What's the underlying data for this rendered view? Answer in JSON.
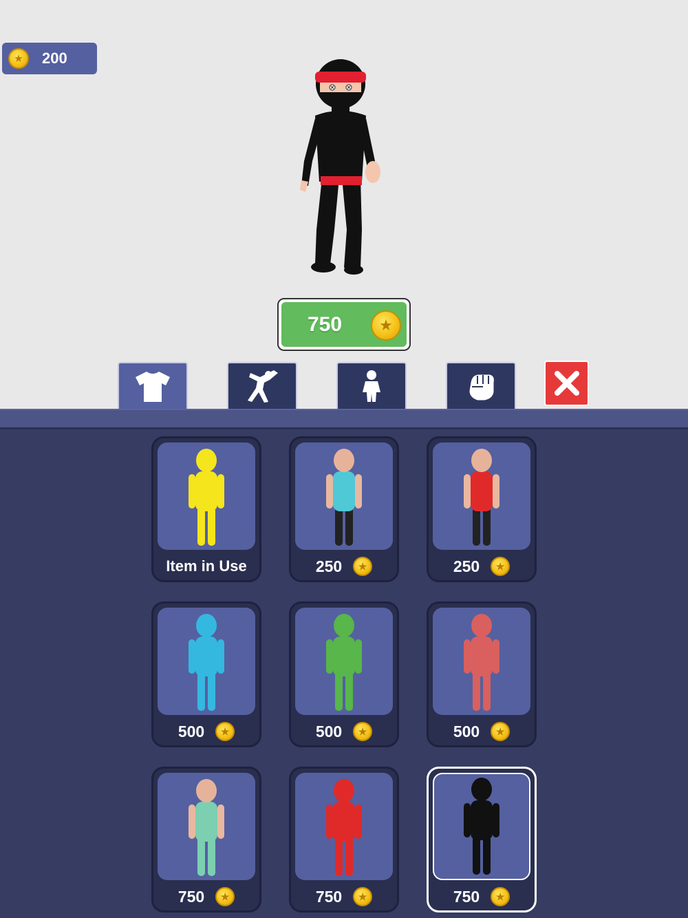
{
  "coins": {
    "count": "200",
    "icon": "star-coin-icon"
  },
  "buy_button": {
    "price": "750"
  },
  "tabs": [
    {
      "name": "tab-outfits",
      "icon": "shirt-icon",
      "active": true
    },
    {
      "name": "tab-dances",
      "icon": "dance-pose-icon",
      "active": false
    },
    {
      "name": "tab-body",
      "icon": "body-icon",
      "active": false
    },
    {
      "name": "tab-fists",
      "icon": "fist-icon",
      "active": false
    }
  ],
  "close_icon": "close-icon",
  "colors": {
    "panel": "#363c62",
    "card": "#5560a0",
    "buy": "#62bb5c",
    "close": "#e63a3a"
  },
  "skins": [
    {
      "label": "Item in Use",
      "in_use": true,
      "body": "#f5e51c",
      "shirt": "#f5e51c",
      "pants": "#f5e51c",
      "head": "#f5e51c"
    },
    {
      "label": "250",
      "body": "#e8b8a0",
      "shirt": "#4fc9d6",
      "pants": "#222",
      "head": "#e6b39a"
    },
    {
      "label": "250",
      "body": "#e8b8a0",
      "shirt": "#e02a2a",
      "pants": "#222",
      "head": "#e6b39a"
    },
    {
      "label": "500",
      "body": "#35b8e0",
      "shirt": "#35b8e0",
      "pants": "#35b8e0",
      "head": "#35b8e0"
    },
    {
      "label": "500",
      "body": "#58b64a",
      "shirt": "#58b64a",
      "pants": "#58b64a",
      "head": "#58b64a"
    },
    {
      "label": "500",
      "body": "#d9605e",
      "shirt": "#d9605e",
      "pants": "#d9605e",
      "head": "#d9605e"
    },
    {
      "label": "750",
      "body": "#e8b8a0",
      "shirt": "#7ccfb0",
      "pants": "#7ccfb0",
      "head": "#e6b39a"
    },
    {
      "label": "750",
      "body": "#e02a2a",
      "shirt": "#e02a2a",
      "pants": "#e02a2a",
      "head": "#e02a2a"
    },
    {
      "label": "750",
      "selected": true,
      "body": "#111",
      "shirt": "#111",
      "pants": "#111",
      "head": "#111"
    }
  ]
}
